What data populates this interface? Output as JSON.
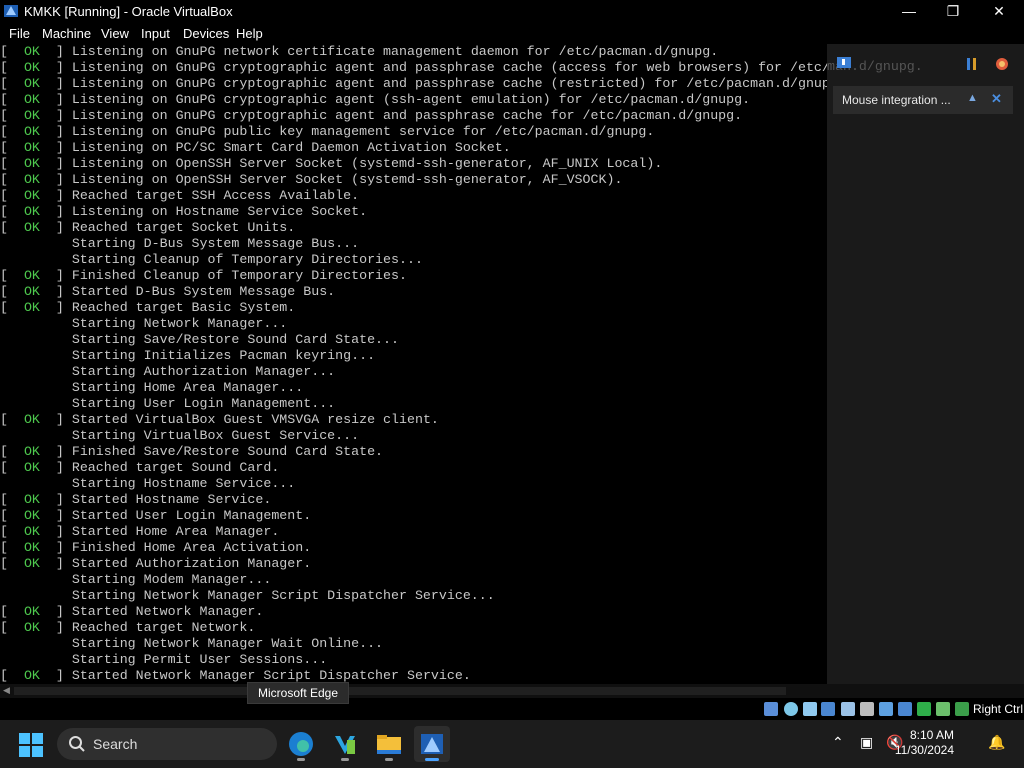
{
  "window": {
    "title": "KMKK [Running] - Oracle VirtualBox",
    "minimize": "—",
    "maximize": "❐",
    "close": "✕"
  },
  "menu": [
    "File",
    "Machine",
    "View",
    "Input",
    "Devices",
    "Help"
  ],
  "console_lines": [
    {
      "status": "OK",
      "text": "Listening on GnuPG network certificate management daemon for /etc/pacman.d/gnupg."
    },
    {
      "status": "OK",
      "text": "Listening on GnuPG cryptographic agent and passphrase cache (access for web browsers) for /etc/"
    },
    {
      "status": "OK",
      "text": "Listening on GnuPG cryptographic agent and passphrase cache (restricted) for /etc/pacman.d/gnup"
    },
    {
      "status": "OK",
      "text": "Listening on GnuPG cryptographic agent (ssh-agent emulation) for /etc/pacman.d/gnupg."
    },
    {
      "status": "OK",
      "text": "Listening on GnuPG cryptographic agent and passphrase cache for /etc/pacman.d/gnupg."
    },
    {
      "status": "OK",
      "text": "Listening on GnuPG public key management service for /etc/pacman.d/gnupg."
    },
    {
      "status": "OK",
      "text": "Listening on PC/SC Smart Card Daemon Activation Socket."
    },
    {
      "status": "OK",
      "text": "Listening on OpenSSH Server Socket (systemd-ssh-generator, AF_UNIX Local)."
    },
    {
      "status": "OK",
      "text": "Listening on OpenSSH Server Socket (systemd-ssh-generator, AF_VSOCK)."
    },
    {
      "status": "OK",
      "text": "Reached target SSH Access Available."
    },
    {
      "status": "OK",
      "text": "Listening on Hostname Service Socket."
    },
    {
      "status": "OK",
      "text": "Reached target Socket Units."
    },
    {
      "status": "",
      "text": "Starting D-Bus System Message Bus..."
    },
    {
      "status": "",
      "text": "Starting Cleanup of Temporary Directories..."
    },
    {
      "status": "OK",
      "text": "Finished Cleanup of Temporary Directories."
    },
    {
      "status": "OK",
      "text": "Started D-Bus System Message Bus."
    },
    {
      "status": "OK",
      "text": "Reached target Basic System."
    },
    {
      "status": "",
      "text": "Starting Network Manager..."
    },
    {
      "status": "",
      "text": "Starting Save/Restore Sound Card State..."
    },
    {
      "status": "",
      "text": "Starting Initializes Pacman keyring..."
    },
    {
      "status": "",
      "text": "Starting Authorization Manager..."
    },
    {
      "status": "",
      "text": "Starting Home Area Manager..."
    },
    {
      "status": "",
      "text": "Starting User Login Management..."
    },
    {
      "status": "OK",
      "text": "Started VirtualBox Guest VMSVGA resize client."
    },
    {
      "status": "",
      "text": "Starting VirtualBox Guest Service..."
    },
    {
      "status": "OK",
      "text": "Finished Save/Restore Sound Card State."
    },
    {
      "status": "OK",
      "text": "Reached target Sound Card."
    },
    {
      "status": "",
      "text": "Starting Hostname Service..."
    },
    {
      "status": "OK",
      "text": "Started Hostname Service."
    },
    {
      "status": "OK",
      "text": "Started User Login Management."
    },
    {
      "status": "OK",
      "text": "Started Home Area Manager."
    },
    {
      "status": "OK",
      "text": "Finished Home Area Activation."
    },
    {
      "status": "OK",
      "text": "Started Authorization Manager."
    },
    {
      "status": "",
      "text": "Starting Modem Manager..."
    },
    {
      "status": "",
      "text": "Starting Network Manager Script Dispatcher Service..."
    },
    {
      "status": "OK",
      "text": "Started Network Manager."
    },
    {
      "status": "OK",
      "text": "Reached target Network."
    },
    {
      "status": "",
      "text": "Starting Network Manager Wait Online..."
    },
    {
      "status": "",
      "text": "Starting Permit User Sessions..."
    },
    {
      "status": "OK",
      "text": "Started Network Manager Script Dispatcher Service."
    }
  ],
  "side_panel": {
    "background_text": "man.d/gnupg.",
    "notification": "Mouse integration ...",
    "pin_icon": "pin-icon",
    "close_icon": "close-icon"
  },
  "status_bar": {
    "host_key": "Right Ctrl",
    "icons": [
      "hard-disk-icon",
      "optical-drive-icon",
      "audio-icon",
      "network-icon",
      "usb-icon",
      "shared-folder-icon",
      "display-icon",
      "video-capture-icon",
      "cpu-icon",
      "arrow-icon",
      "mouse-icon",
      "keyboard-icon"
    ]
  },
  "tooltip": "Microsoft Edge",
  "taskbar": {
    "search_placeholder": "Search",
    "apps": [
      "microsoft-edge-icon",
      "visual-studio-code-icon",
      "file-explorer-icon",
      "virtualbox-icon"
    ],
    "time": "8:10 AM",
    "date": "11/30/2024"
  },
  "colors": {
    "ok_green": "#4ec94e",
    "console_text": "#c8c8c8",
    "taskbar_bg": "#1c1c1c",
    "accent_blue": "#4ca3ff"
  }
}
